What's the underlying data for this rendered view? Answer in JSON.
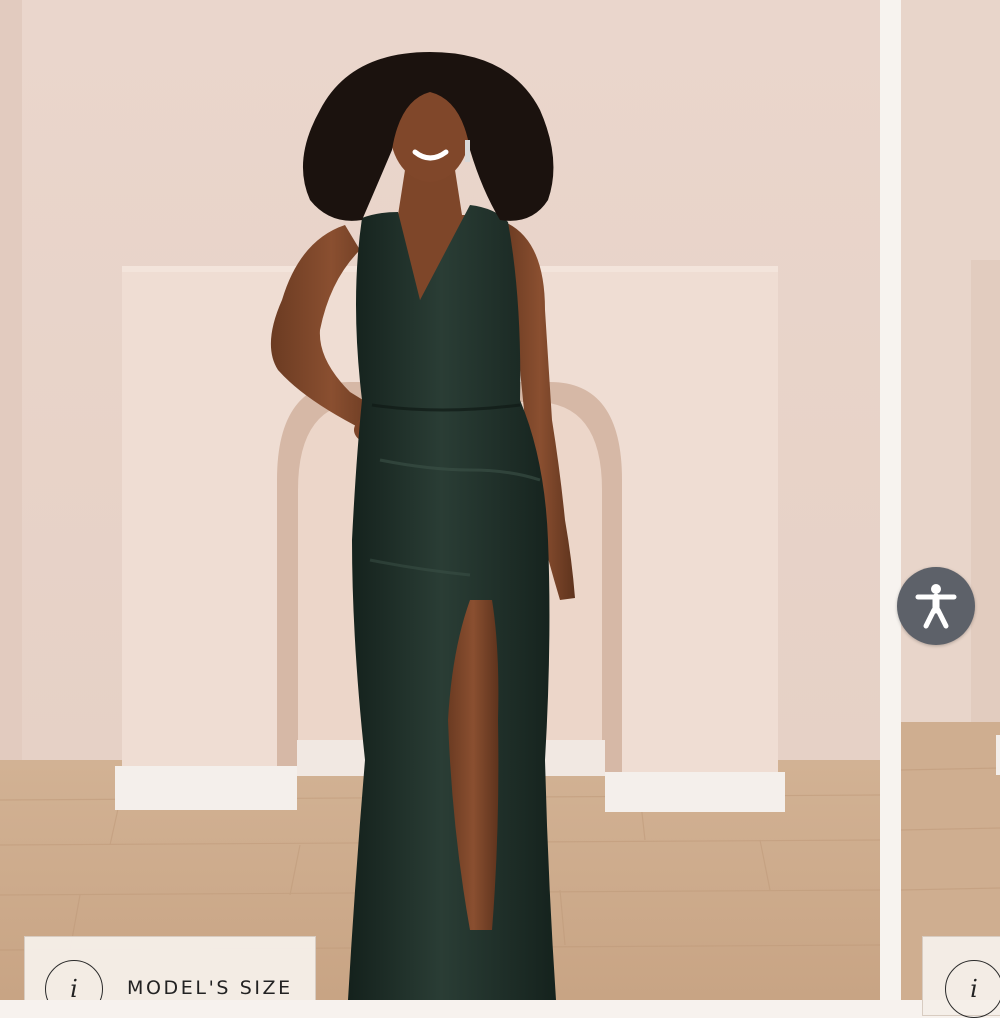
{
  "gallery": {
    "main_image_alt": "Model wearing a dark green velvet V-neck gown with a front slit",
    "info_badge": {
      "icon_glyph": "i",
      "label": "MODEL'S SIZE"
    },
    "next_badge": {
      "icon_glyph": "i"
    }
  },
  "accessibility": {
    "icon": "accessibility-person-icon",
    "color": "#5d6169"
  },
  "colors": {
    "wall": "#e9d6cc",
    "floor": "#cba88a",
    "gown": "#1f2e28"
  }
}
